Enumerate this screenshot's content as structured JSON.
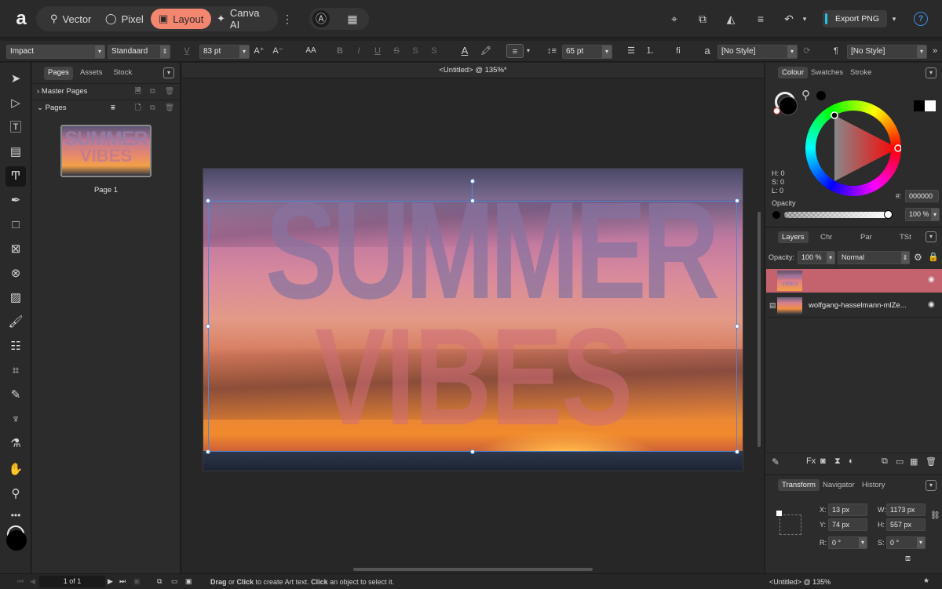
{
  "app": {
    "logo": "a"
  },
  "personas": [
    {
      "label": "Vector",
      "icon": "vector-icon"
    },
    {
      "label": "Pixel",
      "icon": "pixel-icon"
    },
    {
      "label": "Layout",
      "icon": "layout-icon",
      "active": true
    },
    {
      "label": "Canva AI",
      "icon": "sparkle-icon"
    }
  ],
  "toolbar": {
    "export_label": "Export PNG",
    "help": "?",
    "more": "⋮"
  },
  "context": {
    "font": "Impact",
    "style": "Standaard",
    "size": "83 pt",
    "case": "AA",
    "bold": "B",
    "italic": "I",
    "underline": "U",
    "strike": "S",
    "super": "S",
    "sub": "S",
    "leading": "65 pt",
    "ligature": "fi",
    "char_style_icon": "a",
    "char_style": "[No Style]",
    "para_style": "[No Style]",
    "pilcrow": "¶",
    "more": "»"
  },
  "pages_panel": {
    "tabs": [
      "Pages",
      "Assets",
      "Stock"
    ],
    "master_pages": "Master Pages",
    "pages": "Pages",
    "page1_label": "Page 1",
    "thumb_text_1": "SUMMER",
    "thumb_text_2": "VIBES"
  },
  "document": {
    "title": "<Untitled> @ 135%*",
    "art_text_line1": "SUMMER",
    "art_text_line2": "VIBES"
  },
  "colour_panel": {
    "tabs": [
      "Colour",
      "Swatches",
      "Stroke"
    ],
    "h": "H: 0",
    "s": "S: 0",
    "l": "L: 0",
    "hex_label": "#:",
    "hex": "000000",
    "opacity_label": "Opacity",
    "opacity": "100 %",
    "fill": "#000000",
    "accent": "#e0525a"
  },
  "layers_panel": {
    "tabs": [
      "Layers",
      "Chr",
      "Par",
      "TSt"
    ],
    "opacity_label": "Opacity:",
    "opacity": "100 %",
    "blend": "Normal",
    "layers": [
      {
        "name": "",
        "selected": true
      },
      {
        "name": "wolfgang-hasselmann-mlZe..."
      }
    ]
  },
  "transform_panel": {
    "tabs": [
      "Transform",
      "Navigator",
      "History"
    ],
    "x_label": "X:",
    "x": "13 px",
    "y_label": "Y:",
    "y": "74 px",
    "w_label": "W:",
    "w": "1173 px",
    "h_label": "H:",
    "h": "557 px",
    "r_label": "R:",
    "r": "0 °",
    "s_label": "S:",
    "s": "0 °"
  },
  "status": {
    "page": "1 of 1",
    "hint_drag": "Drag",
    "hint_or": " or ",
    "hint_click": "Click",
    "hint_mid": " to create Art text. ",
    "hint_click2": "Click",
    "hint_end": " an object to select it.",
    "zoom": "<Untitled> @ 135%"
  }
}
